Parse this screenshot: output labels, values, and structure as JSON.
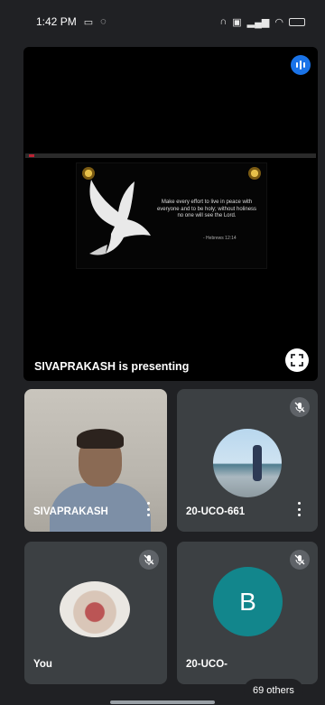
{
  "status_bar": {
    "time": "1:42 PM"
  },
  "presentation": {
    "verse_text": "Make every effort to live in peace with everyone and to be holy; without holiness no one will see the Lord.",
    "verse_ref": "- Hebrews 12:14",
    "presenter_text": "SIVAPRAKASH is presenting"
  },
  "participants": [
    {
      "name": "SIVAPRAKASH"
    },
    {
      "name": "20-UCO-661"
    },
    {
      "name": "You"
    },
    {
      "name": "20-UCO-",
      "avatar_letter": "B",
      "avatar_color": "#12868c"
    }
  ],
  "others_label": "69 others",
  "colors": {
    "background": "#202124",
    "tile": "#3c4043",
    "accent": "#1a73e8"
  }
}
